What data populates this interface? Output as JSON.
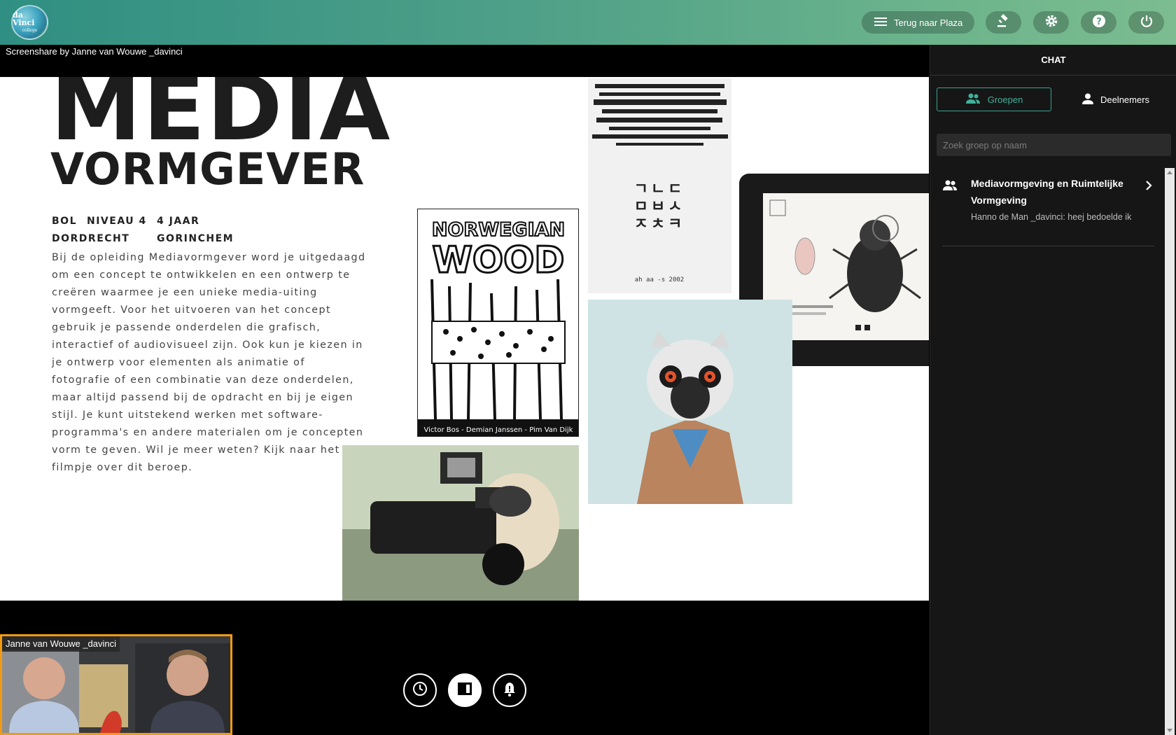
{
  "header": {
    "logo_text": "da Vinci",
    "logo_sub": "college",
    "plaza_button": "Terug naar Plaza",
    "icons": [
      "menu-icon",
      "gavel-icon",
      "gear-icon",
      "help-icon",
      "power-icon"
    ]
  },
  "screenshare": {
    "label": "Screenshare by Janne van Wouwe _davinci"
  },
  "slide": {
    "title_line1": "MEDIA",
    "title_line2": "VORMGEVER",
    "meta_bol": "BOL",
    "meta_level": "NIVEAU 4",
    "meta_duration": "4 JAAR",
    "meta_city1": "DORDRECHT",
    "meta_city2": "GORINCHEM",
    "body": "Bij de opleiding Mediavormgever word je uitgedaagd om een concept te ontwikkelen en een ontwerp te creëren waarmee je een unieke media-uiting vormgeeft. Voor het uitvoeren van het concept gebruik je passende onderdelen die grafisch, interactief of audiovisueel zijn. Ook kun je kiezen in je ontwerp voor elementen als animatie of fotografie of een combinatie van deze onderdelen, maar altijd passend bij de opdracht en bij je eigen stijl. Je kunt uitstekend werken met software-programma's en andere materialen om je concepten vorm te geven. Wil je meer weten? Kijk naar het filmpje over dit beroep.",
    "poster_title1": "NORWEGIAN",
    "poster_title2": "WOOD",
    "poster_caption": "Victor Bos - Demian Janssen - Pim Van Dijk",
    "korean_poster_date": "ah aa -s 2002"
  },
  "chat": {
    "title": "CHAT",
    "tab_groups": "Groepen",
    "tab_participants": "Deelnemers",
    "search_placeholder": "Zoek groep op naam",
    "groups": [
      {
        "name": "Mediavormgeving en Ruimtelijke Vormgeving",
        "last_message": "Hanno de Man _davinci: heej bedoelde ik"
      }
    ]
  },
  "participant": {
    "name": "Janne van Wouwe _davinci"
  },
  "controls": [
    "clock-icon",
    "layout-icon",
    "bell-icon"
  ],
  "colors": {
    "accent": "#3fb09a",
    "video_border": "#f29a14",
    "panel_bg": "#161616"
  }
}
